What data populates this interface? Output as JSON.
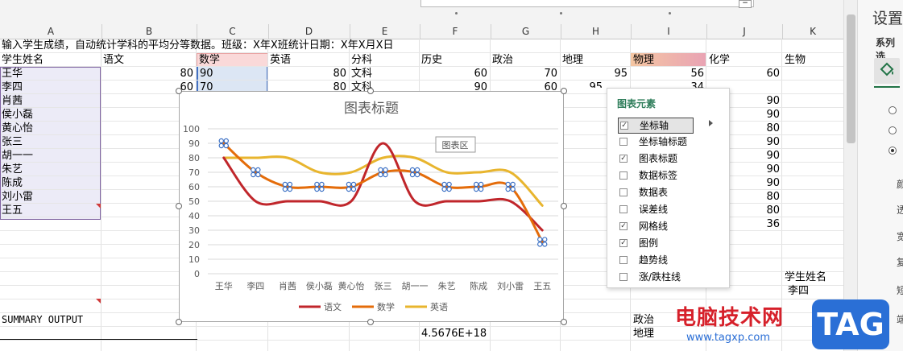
{
  "columns": [
    "A",
    "B",
    "C",
    "D",
    "E",
    "F",
    "G",
    "H",
    "I",
    "J",
    "K"
  ],
  "top_text": "输入学生成绩，自动统计学科的平均分等数据。班级：X年X班统计日期：X年X月X日",
  "headers": {
    "a": "学生姓名",
    "b": "语文",
    "c": "数学",
    "d": "英语",
    "e": "分科",
    "f": "历史",
    "g": "政治",
    "h": "地理",
    "i": "物理",
    "j": "化学",
    "k": "生物"
  },
  "names": [
    "王华",
    "李四",
    "肖茜",
    "侯小磊",
    "黄心怡",
    "张三",
    "胡一一",
    "朱艺",
    "陈成",
    "刘小雷",
    "王五"
  ],
  "row1": {
    "b": "80",
    "c": "90",
    "d": "80",
    "e": "文科",
    "f": "60",
    "g": "70",
    "h": "95",
    "i": "56",
    "j": "60"
  },
  "row2": {
    "b": "60",
    "c": "70",
    "d": "80",
    "e": "文科",
    "f": "90",
    "g": "60",
    "h": "95",
    "i": "34"
  },
  "col_j_rest": [
    "90",
    "90",
    "80",
    "90",
    "90",
    "90",
    "90",
    "80",
    "80",
    "36"
  ],
  "k_lower": [
    "学生姓名",
    "李四"
  ],
  "summary": "SUMMARY OUTPUT",
  "i_lower": [
    "政治",
    "地理"
  ],
  "f_value": "4.5676E+18",
  "chart_data": {
    "type": "line",
    "title": "图表标题",
    "categories": [
      "王华",
      "李四",
      "肖茜",
      "侯小磊",
      "黄心怡",
      "张三",
      "胡一一",
      "朱艺",
      "陈成",
      "刘小雷",
      "王五"
    ],
    "ylim": [
      0,
      100
    ],
    "yticks": [
      0,
      10,
      20,
      30,
      40,
      50,
      60,
      70,
      80,
      90,
      100
    ],
    "grid": true,
    "legend": "bottom",
    "series": [
      {
        "name": "语文",
        "color": "#c0262b",
        "values": [
          80,
          50,
          50,
          50,
          50,
          90,
          50,
          50,
          50,
          50,
          30
        ]
      },
      {
        "name": "数学",
        "color": "#e46c0a",
        "values": [
          90,
          70,
          60,
          60,
          60,
          70,
          70,
          60,
          60,
          60,
          22
        ]
      },
      {
        "name": "英语",
        "color": "#e8b52e",
        "values": [
          80,
          80,
          80,
          70,
          70,
          80,
          80,
          70,
          70,
          70,
          47
        ]
      }
    ]
  },
  "area_tooltip": "图表区",
  "panel": {
    "title": "图表元素",
    "items": [
      {
        "label": "坐标轴",
        "checked": true
      },
      {
        "label": "坐标轴标题",
        "checked": false
      },
      {
        "label": "图表标题",
        "checked": true
      },
      {
        "label": "数据标签",
        "checked": false
      },
      {
        "label": "数据表",
        "checked": false
      },
      {
        "label": "误差线",
        "checked": false
      },
      {
        "label": "网格线",
        "checked": true
      },
      {
        "label": "图例",
        "checked": true
      },
      {
        "label": "趋势线",
        "checked": false
      },
      {
        "label": "涨/跌柱线",
        "checked": false
      }
    ]
  },
  "side": {
    "title": "设置",
    "subtitle": "系列选",
    "labels": [
      "颜",
      "透",
      "宽",
      "复",
      "短",
      "端"
    ]
  },
  "watermark": {
    "site": "电脑技术网",
    "url": "www.tagxp.com",
    "tag": "TAG"
  }
}
